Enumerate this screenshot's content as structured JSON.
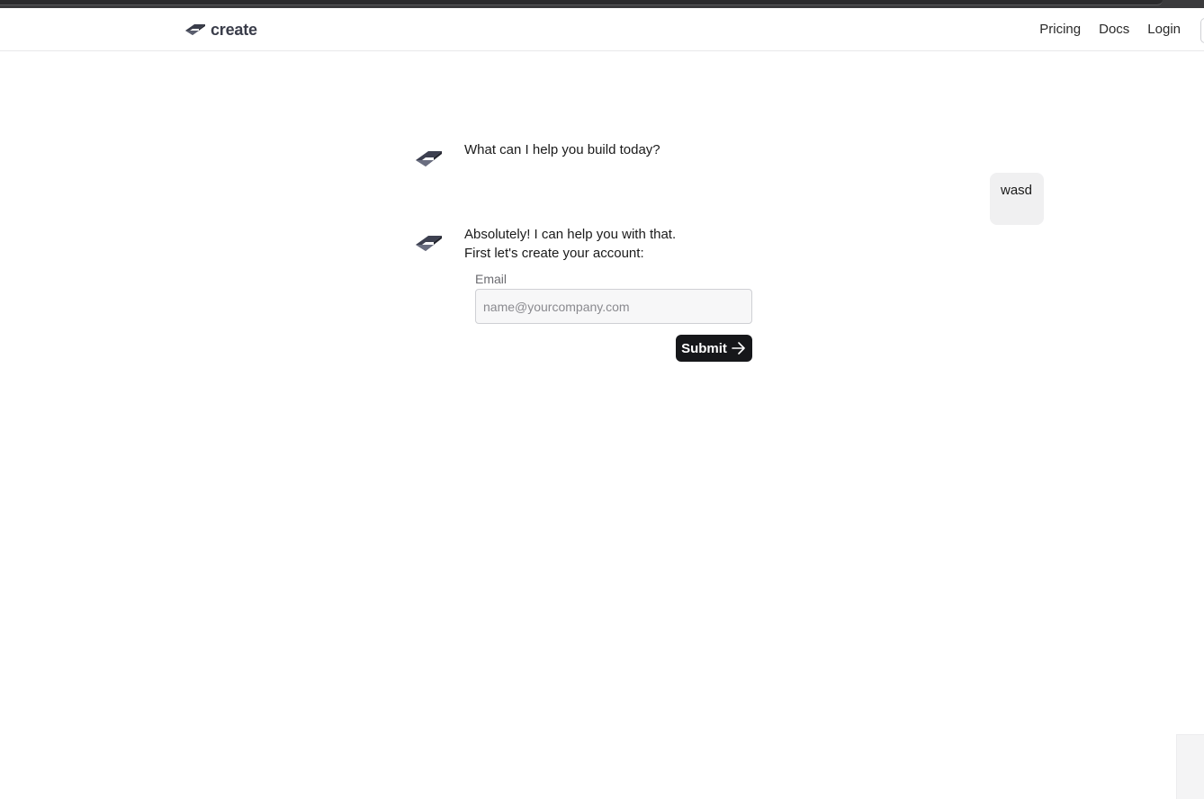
{
  "brand": {
    "name": "create",
    "logo_icon": "create-logo-icon",
    "color": "#3a3d4a"
  },
  "nav": {
    "links": [
      "Pricing",
      "Docs",
      "Login"
    ]
  },
  "conversation": {
    "assistant_greeting": "What can I help you build today?",
    "user_message": "wasd",
    "assistant_reply_line1": "Absolutely! I can help you with that.",
    "assistant_reply_line2": "First let's create your account:"
  },
  "signup_form": {
    "email_label": "Email",
    "email_placeholder": "name@yourcompany.com",
    "email_value": "",
    "submit_label": "Submit",
    "submit_icon": "arrow-right-icon",
    "submit_color": "#16171a"
  }
}
